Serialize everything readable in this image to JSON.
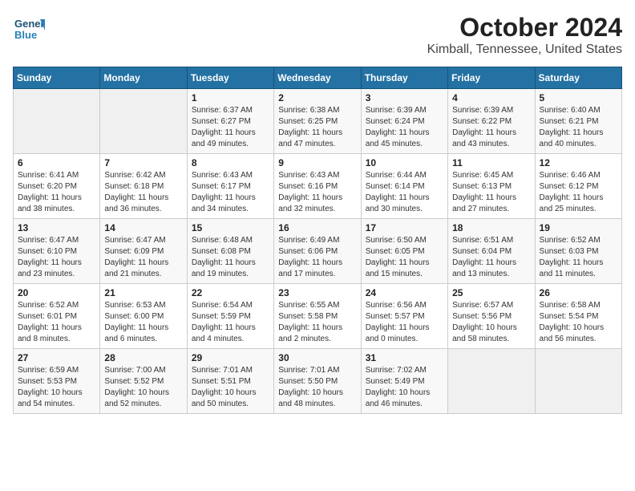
{
  "header": {
    "logo_general": "General",
    "logo_blue": "Blue",
    "title": "October 2024",
    "subtitle": "Kimball, Tennessee, United States"
  },
  "calendar": {
    "days_of_week": [
      "Sunday",
      "Monday",
      "Tuesday",
      "Wednesday",
      "Thursday",
      "Friday",
      "Saturday"
    ],
    "weeks": [
      [
        {
          "num": "",
          "detail": ""
        },
        {
          "num": "",
          "detail": ""
        },
        {
          "num": "1",
          "detail": "Sunrise: 6:37 AM\nSunset: 6:27 PM\nDaylight: 11 hours and 49 minutes."
        },
        {
          "num": "2",
          "detail": "Sunrise: 6:38 AM\nSunset: 6:25 PM\nDaylight: 11 hours and 47 minutes."
        },
        {
          "num": "3",
          "detail": "Sunrise: 6:39 AM\nSunset: 6:24 PM\nDaylight: 11 hours and 45 minutes."
        },
        {
          "num": "4",
          "detail": "Sunrise: 6:39 AM\nSunset: 6:22 PM\nDaylight: 11 hours and 43 minutes."
        },
        {
          "num": "5",
          "detail": "Sunrise: 6:40 AM\nSunset: 6:21 PM\nDaylight: 11 hours and 40 minutes."
        }
      ],
      [
        {
          "num": "6",
          "detail": "Sunrise: 6:41 AM\nSunset: 6:20 PM\nDaylight: 11 hours and 38 minutes."
        },
        {
          "num": "7",
          "detail": "Sunrise: 6:42 AM\nSunset: 6:18 PM\nDaylight: 11 hours and 36 minutes."
        },
        {
          "num": "8",
          "detail": "Sunrise: 6:43 AM\nSunset: 6:17 PM\nDaylight: 11 hours and 34 minutes."
        },
        {
          "num": "9",
          "detail": "Sunrise: 6:43 AM\nSunset: 6:16 PM\nDaylight: 11 hours and 32 minutes."
        },
        {
          "num": "10",
          "detail": "Sunrise: 6:44 AM\nSunset: 6:14 PM\nDaylight: 11 hours and 30 minutes."
        },
        {
          "num": "11",
          "detail": "Sunrise: 6:45 AM\nSunset: 6:13 PM\nDaylight: 11 hours and 27 minutes."
        },
        {
          "num": "12",
          "detail": "Sunrise: 6:46 AM\nSunset: 6:12 PM\nDaylight: 11 hours and 25 minutes."
        }
      ],
      [
        {
          "num": "13",
          "detail": "Sunrise: 6:47 AM\nSunset: 6:10 PM\nDaylight: 11 hours and 23 minutes."
        },
        {
          "num": "14",
          "detail": "Sunrise: 6:47 AM\nSunset: 6:09 PM\nDaylight: 11 hours and 21 minutes."
        },
        {
          "num": "15",
          "detail": "Sunrise: 6:48 AM\nSunset: 6:08 PM\nDaylight: 11 hours and 19 minutes."
        },
        {
          "num": "16",
          "detail": "Sunrise: 6:49 AM\nSunset: 6:06 PM\nDaylight: 11 hours and 17 minutes."
        },
        {
          "num": "17",
          "detail": "Sunrise: 6:50 AM\nSunset: 6:05 PM\nDaylight: 11 hours and 15 minutes."
        },
        {
          "num": "18",
          "detail": "Sunrise: 6:51 AM\nSunset: 6:04 PM\nDaylight: 11 hours and 13 minutes."
        },
        {
          "num": "19",
          "detail": "Sunrise: 6:52 AM\nSunset: 6:03 PM\nDaylight: 11 hours and 11 minutes."
        }
      ],
      [
        {
          "num": "20",
          "detail": "Sunrise: 6:52 AM\nSunset: 6:01 PM\nDaylight: 11 hours and 8 minutes."
        },
        {
          "num": "21",
          "detail": "Sunrise: 6:53 AM\nSunset: 6:00 PM\nDaylight: 11 hours and 6 minutes."
        },
        {
          "num": "22",
          "detail": "Sunrise: 6:54 AM\nSunset: 5:59 PM\nDaylight: 11 hours and 4 minutes."
        },
        {
          "num": "23",
          "detail": "Sunrise: 6:55 AM\nSunset: 5:58 PM\nDaylight: 11 hours and 2 minutes."
        },
        {
          "num": "24",
          "detail": "Sunrise: 6:56 AM\nSunset: 5:57 PM\nDaylight: 11 hours and 0 minutes."
        },
        {
          "num": "25",
          "detail": "Sunrise: 6:57 AM\nSunset: 5:56 PM\nDaylight: 10 hours and 58 minutes."
        },
        {
          "num": "26",
          "detail": "Sunrise: 6:58 AM\nSunset: 5:54 PM\nDaylight: 10 hours and 56 minutes."
        }
      ],
      [
        {
          "num": "27",
          "detail": "Sunrise: 6:59 AM\nSunset: 5:53 PM\nDaylight: 10 hours and 54 minutes."
        },
        {
          "num": "28",
          "detail": "Sunrise: 7:00 AM\nSunset: 5:52 PM\nDaylight: 10 hours and 52 minutes."
        },
        {
          "num": "29",
          "detail": "Sunrise: 7:01 AM\nSunset: 5:51 PM\nDaylight: 10 hours and 50 minutes."
        },
        {
          "num": "30",
          "detail": "Sunrise: 7:01 AM\nSunset: 5:50 PM\nDaylight: 10 hours and 48 minutes."
        },
        {
          "num": "31",
          "detail": "Sunrise: 7:02 AM\nSunset: 5:49 PM\nDaylight: 10 hours and 46 minutes."
        },
        {
          "num": "",
          "detail": ""
        },
        {
          "num": "",
          "detail": ""
        }
      ]
    ]
  }
}
